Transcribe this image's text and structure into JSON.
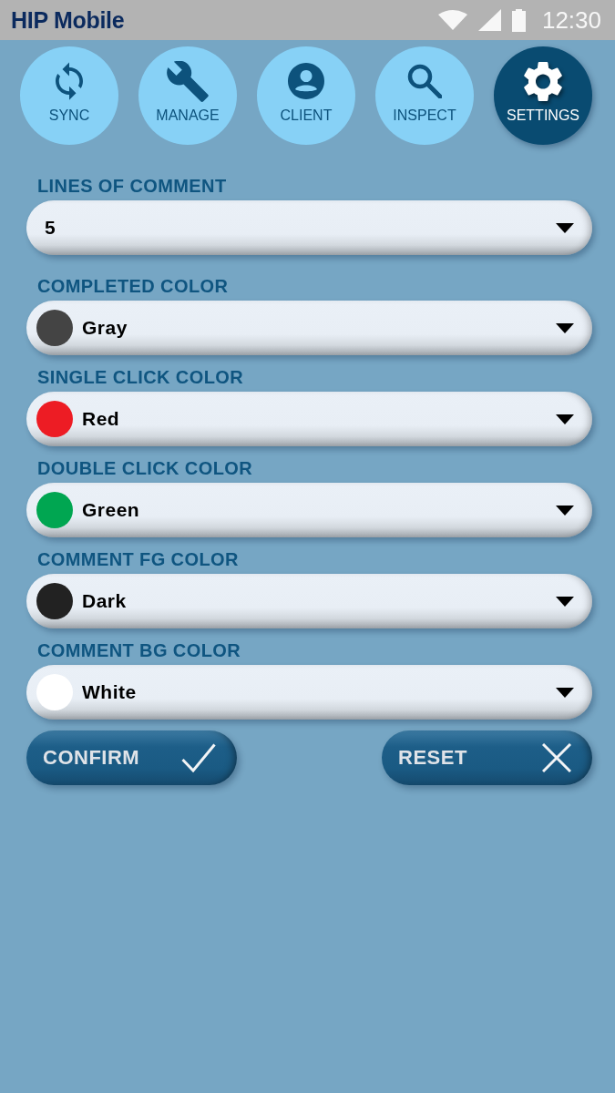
{
  "status_bar": {
    "title": "HIP Mobile",
    "time": "12:30"
  },
  "nav": [
    {
      "label": "SYNC",
      "selected": false
    },
    {
      "label": "MANAGE",
      "selected": false
    },
    {
      "label": "CLIENT",
      "selected": false
    },
    {
      "label": "INSPECT",
      "selected": false
    },
    {
      "label": "SETTINGS",
      "selected": true
    }
  ],
  "settings": [
    {
      "kind": "plain",
      "label": "LINES OF COMMENT",
      "value": "5"
    },
    {
      "kind": "color",
      "label": "COMPLETED COLOR",
      "value": "Gray",
      "color": "#444444"
    },
    {
      "kind": "color",
      "label": "SINGLE CLICK COLOR",
      "value": "Red",
      "color": "#ed1c24"
    },
    {
      "kind": "color",
      "label": "DOUBLE CLICK COLOR",
      "value": "Green",
      "color": "#00a651"
    },
    {
      "kind": "color",
      "label": "COMMENT FG COLOR",
      "value": "Dark",
      "color": "#222222"
    },
    {
      "kind": "color",
      "label": "COMMENT BG COLOR",
      "value": "White",
      "color": "#ffffff"
    }
  ],
  "buttons": [
    {
      "label": "CONFIRM"
    },
    {
      "label": "RESET"
    }
  ]
}
